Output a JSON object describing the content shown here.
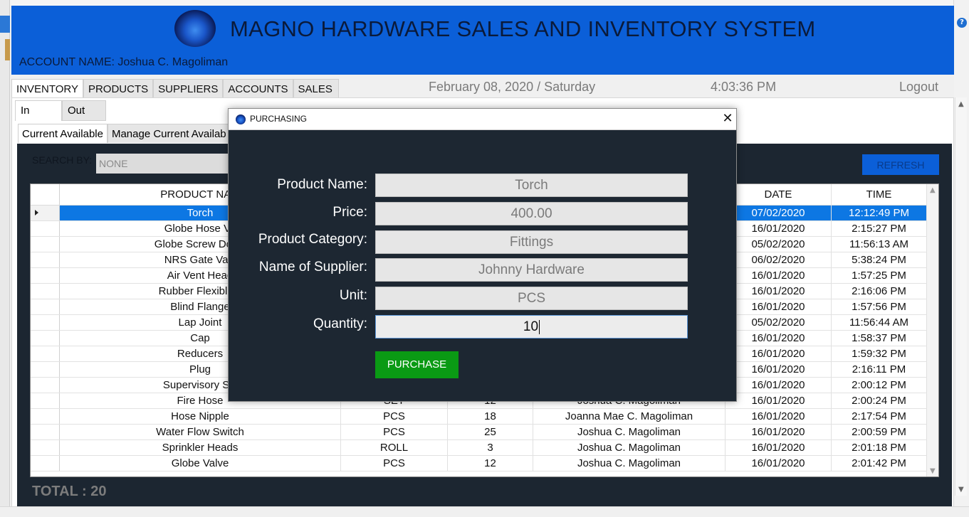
{
  "header": {
    "title": "MAGNO HARDWARE SALES AND INVENTORY SYSTEM",
    "account": "ACCOUNT NAME: Joshua C. Magoliman"
  },
  "tabs": [
    "INVENTORY",
    "PRODUCTS",
    "SUPPLIERS",
    "ACCOUNTS",
    "SALES"
  ],
  "date_text": "February 08, 2020 / Saturday",
  "time_text": "4:03:36 PM",
  "logout_label": "Logout",
  "subtabs": [
    "In",
    "Out"
  ],
  "inner_tabs": [
    "Current Available",
    "Manage Current Availab"
  ],
  "search": {
    "label": "SEARCH BY:",
    "value": "NONE"
  },
  "refresh_label": "REFRESH",
  "grid": {
    "columns": [
      "PRODUCT NAM",
      "",
      "",
      "",
      "DATE",
      "TIME"
    ],
    "rows": [
      [
        "Torch",
        "",
        "",
        "",
        "07/02/2020",
        "12:12:49 PM"
      ],
      [
        "Globe Hose Va",
        "",
        "",
        "",
        "16/01/2020",
        "2:15:27 PM"
      ],
      [
        "Globe Screw Down",
        "",
        "",
        "",
        "05/02/2020",
        "11:56:13 AM"
      ],
      [
        "NRS Gate Valv",
        "",
        "",
        "",
        "06/02/2020",
        "5:38:24 PM"
      ],
      [
        "Air Vent Head",
        "",
        "",
        "",
        "16/01/2020",
        "1:57:25 PM"
      ],
      [
        "Rubber Flexible J",
        "",
        "",
        "",
        "16/01/2020",
        "2:16:06 PM"
      ],
      [
        "Blind Flange",
        "",
        "",
        "",
        "16/01/2020",
        "1:57:56 PM"
      ],
      [
        "Lap Joint",
        "",
        "",
        "",
        "05/02/2020",
        "11:56:44 AM"
      ],
      [
        "Cap",
        "",
        "",
        "",
        "16/01/2020",
        "1:58:37 PM"
      ],
      [
        "Reducers",
        "",
        "",
        "",
        "16/01/2020",
        "1:59:32 PM"
      ],
      [
        "Plug",
        "",
        "",
        "",
        "16/01/2020",
        "2:16:11 PM"
      ],
      [
        "Supervisory Sw",
        "",
        "",
        "",
        "16/01/2020",
        "2:00:12 PM"
      ],
      [
        "Fire Hose",
        "SET",
        "12",
        "Joshua C. Magoliman",
        "16/01/2020",
        "2:00:24 PM"
      ],
      [
        "Hose Nipple",
        "PCS",
        "18",
        "Joanna Mae C. Magoliman",
        "16/01/2020",
        "2:17:54 PM"
      ],
      [
        "Water Flow Switch",
        "PCS",
        "25",
        "Joshua C. Magoliman",
        "16/01/2020",
        "2:00:59 PM"
      ],
      [
        "Sprinkler Heads",
        "ROLL",
        "3",
        "Joshua C. Magoliman",
        "16/01/2020",
        "2:01:18 PM"
      ],
      [
        "Globe Valve",
        "PCS",
        "12",
        "Joshua C. Magoliman",
        "16/01/2020",
        "2:01:42 PM"
      ]
    ]
  },
  "total_label": "TOTAL : 20",
  "dialog": {
    "title": "PURCHASING",
    "close": "✕",
    "fields": [
      {
        "label": "Product Name:",
        "value": "Torch"
      },
      {
        "label": "Price:",
        "value": "400.00"
      },
      {
        "label": "Product Category:",
        "value": "Fittings"
      },
      {
        "label": "Name of Supplier:",
        "value": "Johnny Hardware"
      },
      {
        "label": "Unit:",
        "value": "PCS"
      },
      {
        "label": "Quantity:",
        "value": "10"
      }
    ],
    "purchase_label": "PURCHASE"
  },
  "help_icon": "?",
  "colors": {
    "header_blue": "#0b5fd8",
    "dark_panel": "#1c2631",
    "selection": "#0d77e3",
    "purchase_green": "#0a9a14"
  }
}
